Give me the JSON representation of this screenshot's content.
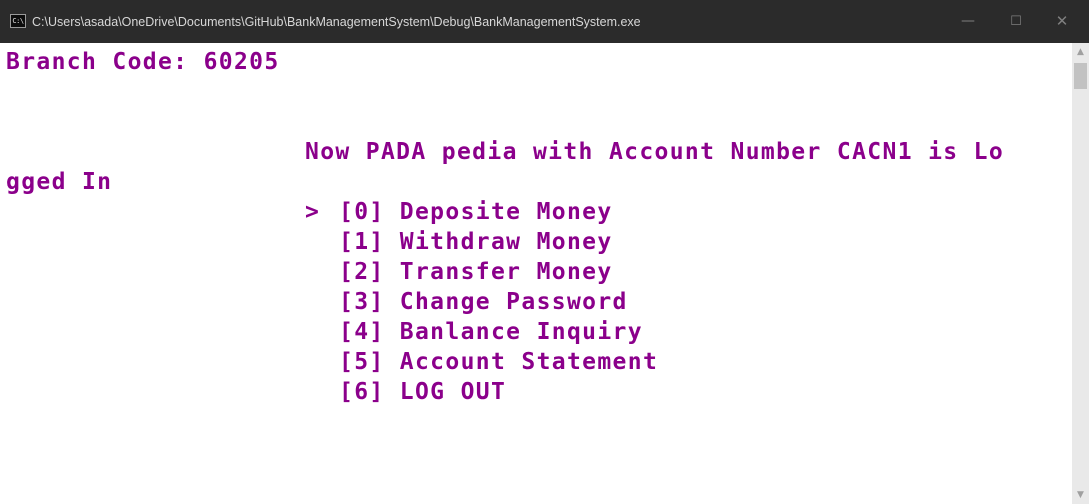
{
  "window": {
    "title": "C:\\Users\\asada\\OneDrive\\Documents\\GitHub\\BankManagementSystem\\Debug\\BankManagementSystem.exe",
    "icon_label": "C:\\",
    "minimize_glyph": "—",
    "maximize_glyph": "☐",
    "close_glyph": "✕"
  },
  "console": {
    "branch_line": "Branch Code: 60205",
    "login_line_1": "Now PADA pedia with Account Number CACN1 is Lo",
    "login_line_2": "gged In",
    "menu": [
      {
        "marker": "> ",
        "label": "[0] Deposite Money"
      },
      {
        "marker": "  ",
        "label": "[1] Withdraw Money"
      },
      {
        "marker": "  ",
        "label": "[2] Transfer Money"
      },
      {
        "marker": "  ",
        "label": "[3] Change Password"
      },
      {
        "marker": "  ",
        "label": "[4] Banlance Inquiry"
      },
      {
        "marker": "  ",
        "label": "[5] Account Statement"
      },
      {
        "marker": "  ",
        "label": "[6] LOG OUT"
      }
    ]
  },
  "scrollbar": {
    "up_glyph": "▲",
    "down_glyph": "▼"
  },
  "colors": {
    "text": "#8b008b",
    "background": "#ffffff",
    "titlebar": "#2b2b2b"
  }
}
